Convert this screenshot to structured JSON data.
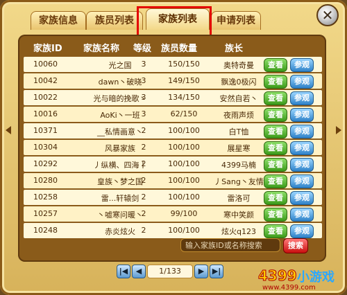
{
  "tabs": [
    {
      "label": "家族信息"
    },
    {
      "label": "族员列表"
    },
    {
      "label": "家族列表"
    },
    {
      "label": "申请列表"
    }
  ],
  "columns": {
    "id": "家族ID",
    "name": "家族名称",
    "level": "等级",
    "count": "族员数量",
    "leader": "族长"
  },
  "rows": [
    {
      "id": "10060",
      "name": "光之国",
      "level": "3",
      "count": "150/150",
      "leader": "奥特奇曼"
    },
    {
      "id": "10042",
      "name": "dawn丶破晓",
      "level": "3",
      "count": "149/150",
      "leader": "飘逸0极闪"
    },
    {
      "id": "10022",
      "name": "光与暗的挽歌丶",
      "level": "3",
      "count": "134/150",
      "leader": "安然自若丶"
    },
    {
      "id": "10016",
      "name": "AoKi丶一班",
      "level": "3",
      "count": "62/150",
      "leader": "夜雨声烦"
    },
    {
      "id": "10371",
      "name": "__私情画意丶",
      "level": "2",
      "count": "100/100",
      "leader": "白T恤"
    },
    {
      "id": "10304",
      "name": "风暴家族",
      "level": "2",
      "count": "100/100",
      "leader": "展星寒"
    },
    {
      "id": "10292",
      "name": "丿纵横、四海丨",
      "level": "2",
      "count": "100/100",
      "leader": "4399马楠"
    },
    {
      "id": "10280",
      "name": "皇族丶梦之国",
      "level": "2",
      "count": "100/100",
      "leader": "丿Sang丶友情"
    },
    {
      "id": "10258",
      "name": "雷...轩辕剑",
      "level": "2",
      "count": "100/100",
      "leader": "雷洛可"
    },
    {
      "id": "10257",
      "name": "丶嘘寒问暖丶",
      "level": "2",
      "count": "99/100",
      "leader": "寒中笑颜"
    },
    {
      "id": "10248",
      "name": "赤炎炫火",
      "level": "2",
      "count": "100/100",
      "leader": "炫火q123"
    }
  ],
  "buttons": {
    "view": "查看",
    "visit": "参观"
  },
  "search": {
    "placeholder": "输入家族ID或名称搜索",
    "button": "搜索"
  },
  "pager": {
    "info": "1/133",
    "first": "|◀",
    "prev": "◀",
    "next": "▶",
    "last": "▶|"
  },
  "close_label": "✕",
  "brand": {
    "main": "4399",
    "cn": "小游戏",
    "url": "www.4399.com"
  }
}
